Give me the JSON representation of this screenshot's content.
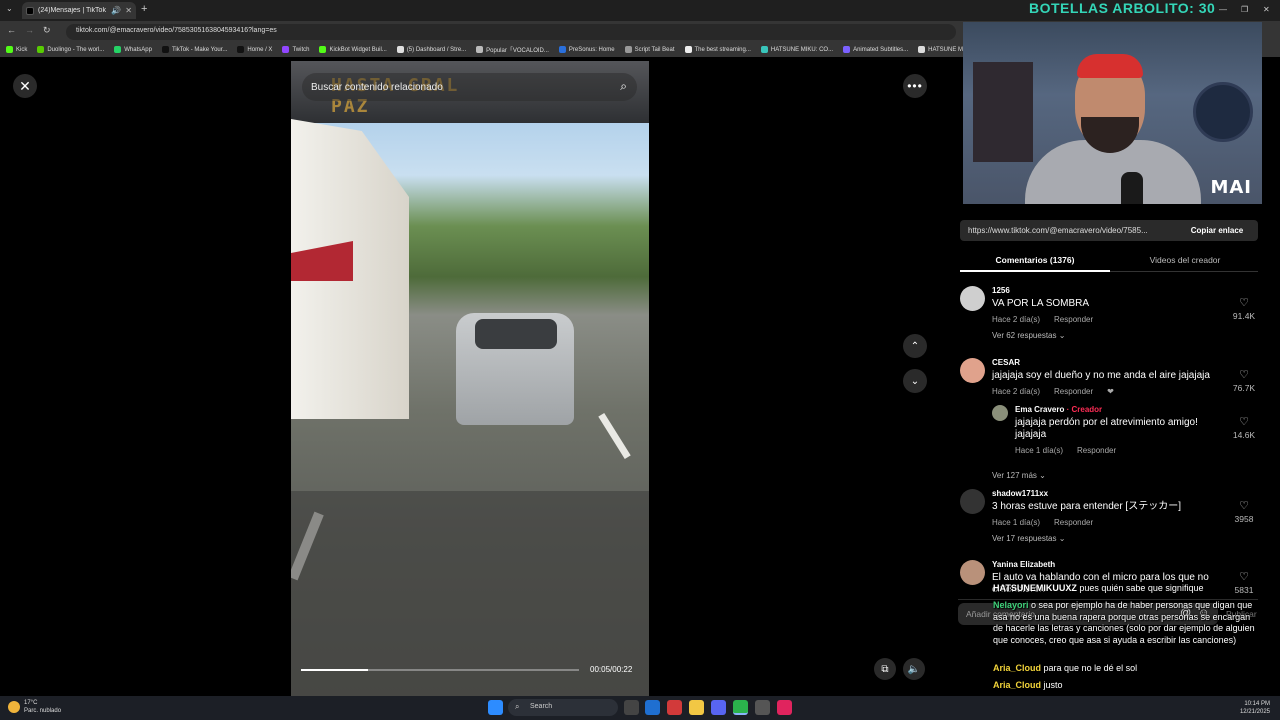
{
  "browser": {
    "tab_title": "(24)Mensajes | TikTok",
    "url": "tiktok.com/@emacravero/video/7585305163804593416?lang=es",
    "bookmarks": [
      {
        "label": "Kick",
        "color": "#53fc18"
      },
      {
        "label": "Duolingo - The worl...",
        "color": "#58cc02"
      },
      {
        "label": "WhatsApp",
        "color": "#25d366"
      },
      {
        "label": "TikTok - Make Your...",
        "color": "#111111"
      },
      {
        "label": "Home / X",
        "color": "#111111"
      },
      {
        "label": "Twitch",
        "color": "#9146ff"
      },
      {
        "label": "KickBot Widget Buil...",
        "color": "#53fc18"
      },
      {
        "label": "(5) Dashboard / Stre...",
        "color": "#e0e0e0"
      },
      {
        "label": "Popular「VOCALOID...",
        "color": "#bbbbbb"
      },
      {
        "label": "PreSonus: Home",
        "color": "#2a6fdb"
      },
      {
        "label": "Script Tail Beat",
        "color": "#999999"
      },
      {
        "label": "The best streaming...",
        "color": "#eeeeee"
      },
      {
        "label": "HATSUNE MIKU: CO...",
        "color": "#39c5bb"
      },
      {
        "label": "Animated Subtitles...",
        "color": "#7b61ff"
      },
      {
        "label": "HATSUNE M",
        "color": "#dddddd"
      }
    ]
  },
  "stream_overlay": {
    "title": "BOTELLAS ARBOLITO: 30",
    "brand": "MAI",
    "title_color": "#34d6b8"
  },
  "video": {
    "search_placeholder": "Buscar contenido relacionado",
    "sign_text": "HASTA GRAL PAZ",
    "time": "00:05/00:22",
    "progress_fraction": 0.24
  },
  "panel": {
    "link_url": "https://www.tiktok.com/@emacravero/video/7585...",
    "copy_label": "Copiar enlace",
    "tab_comments": "Comentarios (1376)",
    "tab_creator": "Videos del creador",
    "comment_placeholder": "Añadir comentario...",
    "publish_label": "Publicar",
    "comments": [
      {
        "user": "1256",
        "text": "VA POR LA SOMBRA",
        "time": "Hace 2 día(s)",
        "reply": "Responder",
        "likes": "91.4K",
        "more": "Ver 62 respuestas",
        "avatar_color": "#cfcfcf"
      },
      {
        "user": "CESAR",
        "text": "jajajaja soy el dueño y no me anda el aire jajajaja",
        "time": "Hace 2 día(s)",
        "reply": "Responder",
        "likes": "76.7K",
        "avatar_color": "#e0a28c"
      },
      {
        "user": "Ema Cravero",
        "creator_tag": "· Creador",
        "text": "jajajaja perdón por el atrevimiento amigo! jajajaja",
        "time": "Hace 1 día(s)",
        "reply": "Responder",
        "likes": "14.6K",
        "more": "Ver 127 más",
        "avatar_color": "#8a8f7a"
      },
      {
        "user": "shadow1711xx",
        "text": "3 horas estuve para entender [ステッカー]",
        "time": "Hace 1 día(s)",
        "reply": "Responder",
        "likes": "3958",
        "more": "Ver 17 respuestas",
        "avatar_color": "#333333"
      },
      {
        "user": "Yanina Elizabeth",
        "text": "El auto va hablando con el micro para los que no entendieron",
        "likes": "5831",
        "avatar_color": "#b9917a"
      }
    ]
  },
  "chat": [
    {
      "name": "HATSUNEMIKUUXZ",
      "name_color": "#ffffff",
      "text": "pues quién sabe que signifique"
    },
    {
      "name": "Nelayori",
      "name_color": "#3fd17a",
      "text": "o sea por ejemplo ha de haber personas que digan que asa no es una buena rapera porque otras personas se encargan de hacerle las letras y canciones (solo por dar ejemplo de alguien que conoces, creo que asa si ayuda a escribir las canciones)"
    },
    {
      "name": "Aria_Cloud",
      "name_color": "#f2d43a",
      "text": "para que no le dé el sol"
    },
    {
      "name": "Aria_Cloud",
      "name_color": "#f2d43a",
      "text": "justo"
    }
  ],
  "taskbar": {
    "temp": "17°C",
    "weather": "Parc. nublado",
    "search": "Search",
    "time": "10:14 PM",
    "date": "12/21/2025"
  }
}
